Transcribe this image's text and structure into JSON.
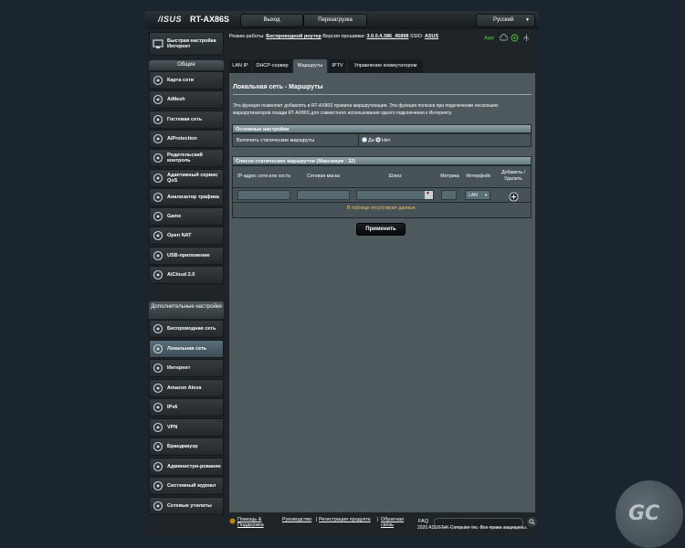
{
  "header": {
    "logo": "/ISUS",
    "model": "RT-AX86S",
    "logout": "Выход",
    "reboot": "Перезагрузка",
    "language": "Русский"
  },
  "status": {
    "mode_label": "Режим работы:",
    "mode_value": "Беспроводной роутер",
    "fw_label": "Версия прошивки:",
    "fw_value": "3.0.0.4.386_45898",
    "ssid_label": "SSID:",
    "ssid_value": "ASUS",
    "app": "App"
  },
  "sidebar": {
    "quick": "Быстрая настройка Интернет",
    "general_header": "Общие",
    "general": [
      {
        "label": "Карта сети",
        "icon": "network-map-icon"
      },
      {
        "label": "AiMesh",
        "icon": "aimesh-icon"
      },
      {
        "label": "Гостевая сеть",
        "icon": "guest-network-icon"
      },
      {
        "label": "AiProtection",
        "icon": "shield-icon"
      },
      {
        "label": "Родительский контроль",
        "icon": "parental-control-icon"
      },
      {
        "label": "Адаптивный сервис QoS",
        "icon": "qos-icon"
      },
      {
        "label": "Анализатор трафика",
        "icon": "traffic-analyzer-icon"
      },
      {
        "label": "Game",
        "icon": "gamepad-icon"
      },
      {
        "label": "Open NAT",
        "icon": "open-nat-icon"
      },
      {
        "label": "USB-приложение",
        "icon": "usb-icon"
      },
      {
        "label": "AiCloud 2.0",
        "icon": "cloud-icon"
      }
    ],
    "advanced_header": "Дополнительные настройки",
    "advanced": [
      {
        "label": "Беспроводная сеть",
        "icon": "wireless-icon"
      },
      {
        "label": "Локальная сеть",
        "icon": "lan-icon"
      },
      {
        "label": "Интернет",
        "icon": "globe-icon"
      },
      {
        "label": "Amazon Alexa",
        "icon": "alexa-icon"
      },
      {
        "label": "IPv6",
        "icon": "ipv6-icon"
      },
      {
        "label": "VPN",
        "icon": "vpn-icon"
      },
      {
        "label": "Брандмауэр",
        "icon": "firewall-icon"
      },
      {
        "label": "Администри-рование",
        "icon": "admin-icon"
      },
      {
        "label": "Системный журнал",
        "icon": "syslog-icon"
      },
      {
        "label": "Сетевые утилиты",
        "icon": "tools-icon"
      }
    ]
  },
  "tabs": [
    {
      "label": "LAN IP"
    },
    {
      "label": "DHCP-сервер"
    },
    {
      "label": "Маршруты"
    },
    {
      "label": "IPTV"
    },
    {
      "label": "Управление коммутатором"
    }
  ],
  "main": {
    "title": "Локальная сеть - Маршруты",
    "description": "Эта функция позволяет добавлять в RT-AX86S правила маршрутизации. Эта функция полезна при подключении нескольких маршрутизаторов позади RT-AX86S для совместного использования одного подключения к Интернету.",
    "basic_header": "Основные настройки",
    "enable_label": "Включить статические маршруты",
    "yes": "Да",
    "no": "Нет",
    "list_header": "Список статических маршрутов (Максимум : 32)",
    "columns": [
      "IP-адрес сети или хоста",
      "Сетевая маска",
      "Шлюз",
      "Метрика",
      "Интерфейс",
      "Добавить / Удалить"
    ],
    "interface_value": "LAN",
    "empty": "В таблице отсутствуют данные.",
    "apply": "Применить"
  },
  "footer": {
    "help": "Помощь & Поддержка",
    "manual": "Руководство",
    "register": "Регистрация продукта",
    "feedback": "Обратная связь",
    "faq": "FAQ",
    "copyright": "2020 ASUSTeK Computer Inc. Все права защищены."
  }
}
